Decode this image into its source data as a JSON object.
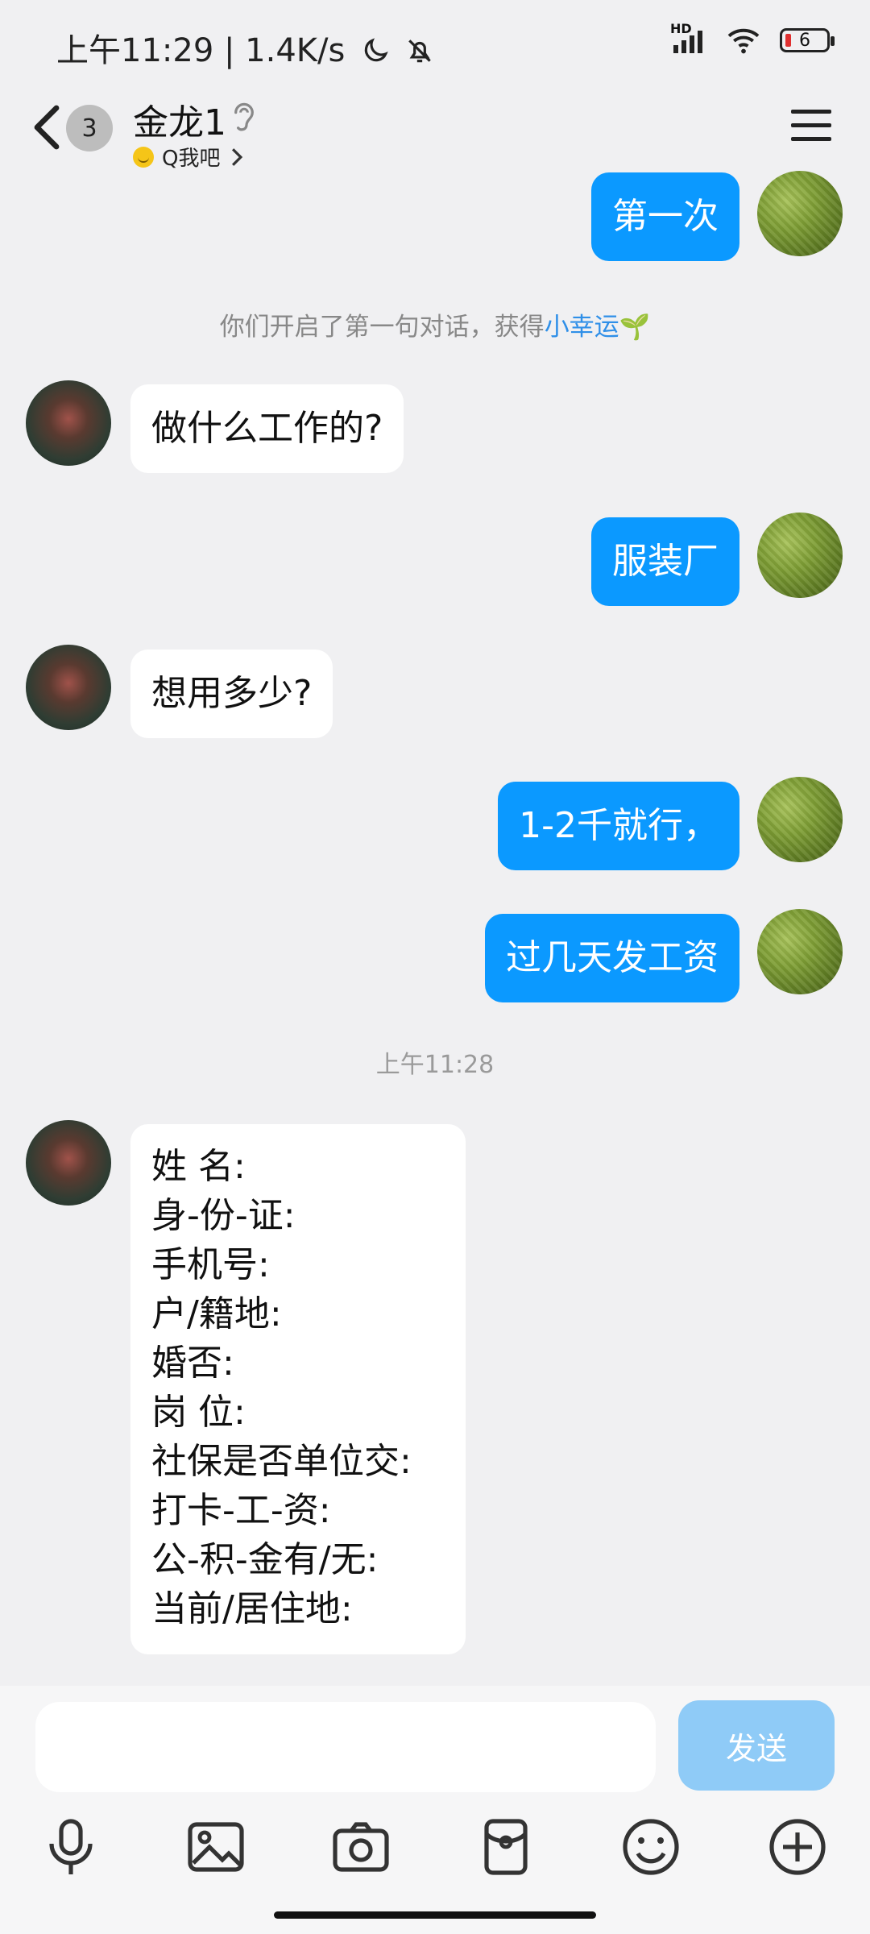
{
  "status": {
    "time": "上午11:29 | 1.4K/s",
    "network": "HD",
    "battery": "6"
  },
  "header": {
    "unread_count": "3",
    "title": "金龙1",
    "subtitle": "Q我吧"
  },
  "system_notice": {
    "prefix": "你们开启了第一句对话，获得",
    "link": "小幸运",
    "emoji": "🌱"
  },
  "messages": [
    {
      "side": "me",
      "text": "第一次"
    },
    {
      "side": "them",
      "text": "做什么工作的?"
    },
    {
      "side": "me",
      "text": "服装厂"
    },
    {
      "side": "them",
      "text": "想用多少?"
    },
    {
      "side": "me",
      "text": "1-2千就行，"
    },
    {
      "side": "me",
      "text": "过几天发工资"
    }
  ],
  "timestamp": "上午11:28",
  "form_message": {
    "lines": [
      "姓 名:",
      "身-份-证:",
      "手机号:",
      "户/籍地:",
      "婚否:",
      "岗 位:",
      "社保是否单位交:",
      "打卡-工-资:",
      "公-积-金有/无:",
      "当前/居住地:"
    ]
  },
  "input": {
    "placeholder": "",
    "send_label": "发送"
  },
  "toolbar": [
    "mic-icon",
    "image-icon",
    "camera-icon",
    "red-packet-icon",
    "emoji-icon",
    "plus-icon"
  ],
  "colors": {
    "bubble_me": "#0b99ff",
    "bubble_them": "#ffffff",
    "send_disabled": "#8fcbf7",
    "link": "#2f8fe8"
  }
}
